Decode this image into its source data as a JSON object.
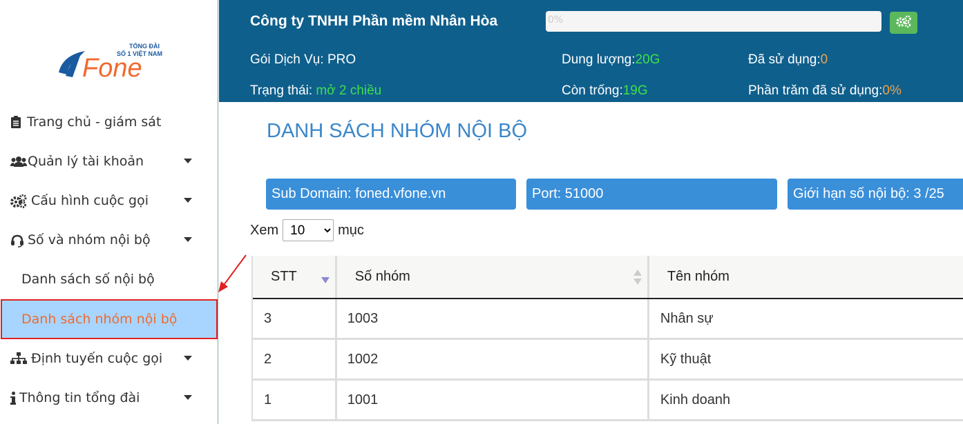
{
  "sidebar": {
    "logo": {
      "brand": "Fone",
      "tagline_top": "TỔNG ĐÀI",
      "tagline_bottom": "SỐ 1 VIỆT NAM"
    },
    "items": [
      {
        "label": "Trang chủ - giám sát",
        "icon": "clipboard-icon"
      },
      {
        "label": "Quản lý tài khoản",
        "icon": "users-icon"
      },
      {
        "label": "Cấu hình cuộc gọi",
        "icon": "gears-icon"
      },
      {
        "label": "Số và nhóm nội bộ",
        "icon": "headset-icon"
      },
      {
        "label": "Danh sách số nội bộ"
      },
      {
        "label": "Danh sách nhóm nội bộ"
      },
      {
        "label": "Định tuyến cuộc gọi",
        "icon": "sitemap-icon"
      },
      {
        "label": "Thông tin tổng đài",
        "icon": "info-icon"
      }
    ]
  },
  "header": {
    "company": "Công ty TNHH Phần mềm Nhân Hòa",
    "progress_text": "0%",
    "package_label": "Gói Dịch Vụ:",
    "package_value": "PRO",
    "status_label": "Trạng thái:",
    "status_value": "mở 2 chiều",
    "capacity_label": "Dung lượng:",
    "capacity_value": "20G",
    "free_label": "Còn trống:",
    "free_value": "19G",
    "used_label": "Đã sử dụng:",
    "used_value": "0",
    "used_pct_label": "Phần trăm đã sử dụng:",
    "used_pct_value": "0%"
  },
  "main": {
    "title": "DANH SÁCH NHÓM NỘI BỘ",
    "info": {
      "subdomain": "Sub Domain:  foned.vfone.vn",
      "port": "Port:  51000",
      "limit": "Giới hạn số nội bộ:  3  /25"
    },
    "show_prefix": "Xem",
    "show_value": "10",
    "show_suffix": "mục",
    "table": {
      "headers": [
        "STT",
        "Số nhóm",
        "Tên nhóm"
      ],
      "rows": [
        [
          "3",
          "1003",
          "Nhân sự"
        ],
        [
          "2",
          "1002",
          "Kỹ thuật"
        ],
        [
          "1",
          "1001",
          "Kinh doanh"
        ]
      ]
    }
  },
  "colors": {
    "header_bg": "#0f5f8c",
    "accent_blue": "#3a8fd9",
    "highlight_green": "#3fe04a",
    "highlight_orange": "#f0a24a",
    "active_bg": "#a8d5ff",
    "active_text": "#ef6a2e"
  }
}
